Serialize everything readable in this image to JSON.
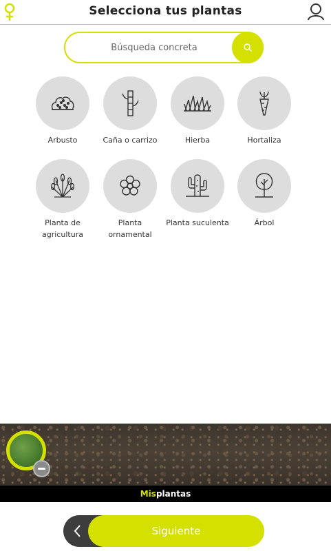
{
  "header": {
    "title": "Selecciona tus plantas",
    "logo_icon": "plant-pin-icon",
    "user_icon": "user-icon"
  },
  "search": {
    "placeholder": "Búsqueda concreta",
    "value": "",
    "icon": "search-icon"
  },
  "categories": [
    {
      "label": "Arbusto",
      "icon": "shrub-icon"
    },
    {
      "label": "Caña o carrizo",
      "icon": "cane-icon"
    },
    {
      "label": "Hierba",
      "icon": "grass-icon"
    },
    {
      "label": "Hortaliza",
      "icon": "carrot-icon"
    },
    {
      "label": "Planta de agricultura",
      "icon": "wheat-icon"
    },
    {
      "label": "Planta ornamental",
      "icon": "flower-icon"
    },
    {
      "label": "Planta suculenta",
      "icon": "cactus-icon"
    },
    {
      "label": "Árbol",
      "icon": "tree-icon"
    }
  ],
  "my_plants": {
    "mis": "Mis",
    "plantas": "plantas"
  },
  "footer": {
    "next_label": "Siguiente"
  },
  "colors": {
    "accent": "#d4e000",
    "circle": "#dddddd",
    "dark": "#3d3d3d"
  }
}
